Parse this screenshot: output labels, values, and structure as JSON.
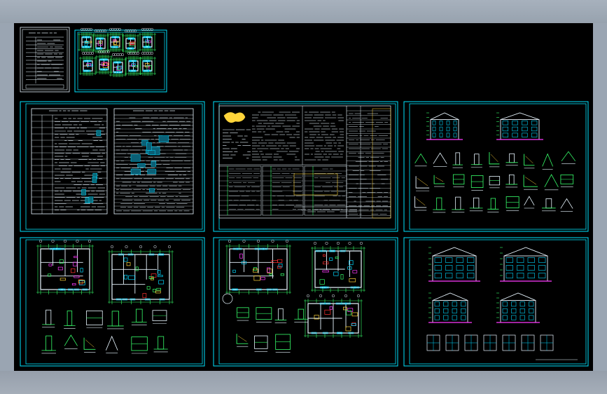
{
  "app": {
    "viewport_background": "#9aa5b2",
    "model_space_background": "#000000"
  },
  "colors": {
    "frame": "#00e5ff",
    "white": "#e8f6ff",
    "green": "#37ff6a",
    "magenta": "#ff3bff",
    "yellow": "#ffd43a",
    "red": "#ff3030",
    "cyan": "#00d8ff"
  },
  "sheets": [
    {
      "id": "cover-list",
      "icon": "cover-sheet-icon"
    },
    {
      "id": "thumbnail-plans",
      "icon": "thumbnail-plans-icon"
    },
    {
      "id": "design-notes-table",
      "icon": "schedule-table-icon"
    },
    {
      "id": "construction-notes",
      "icon": "notes-sheet-icon"
    },
    {
      "id": "details",
      "icon": "details-sheet-icon"
    },
    {
      "id": "floor-plan-a",
      "icon": "floor-plan-icon"
    },
    {
      "id": "floor-plan-b",
      "icon": "floor-plan-icon"
    },
    {
      "id": "elevations",
      "icon": "elevation-sheet-icon"
    }
  ]
}
